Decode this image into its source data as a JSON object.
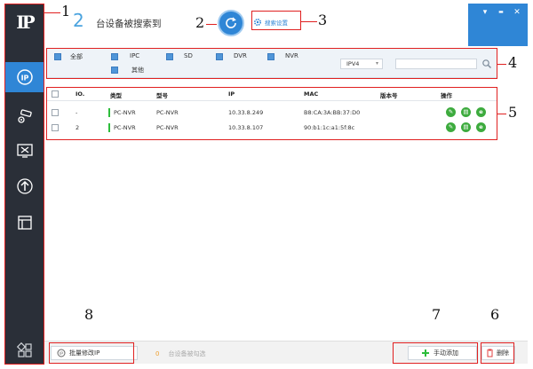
{
  "header": {
    "count": "2",
    "text": "台设备被搜索到",
    "settings_label": "搜索设置"
  },
  "window": {
    "menu_glyph": "▾",
    "minimize_glyph": "▬",
    "close_glyph": "✕"
  },
  "sidebar": {
    "logo": "IP",
    "items": [
      "ip-search-icon",
      "camera-settings-icon",
      "tools-icon",
      "upgrade-icon",
      "window-list-icon",
      "apps-icon"
    ]
  },
  "filter": {
    "types": [
      "全部",
      "IPC",
      "SD",
      "DVR",
      "NVR",
      "其他"
    ],
    "ip_version": "IPV4",
    "search_value": ""
  },
  "table": {
    "headers": [
      "IO.",
      "类型",
      "型号",
      "IP",
      "MAC",
      "版本号",
      "操作"
    ],
    "rows": [
      {
        "no": "-",
        "type": "PC-NVR",
        "model": "PC-NVR",
        "ip": "10.33.8.249",
        "mac": "B8:CA:3A:BB:37:D0",
        "version": ""
      },
      {
        "no": "2",
        "type": "PC-NVR",
        "model": "PC-NVR",
        "ip": "10.33.8.107",
        "mac": "90:b1:1c:a1:5f:8c",
        "version": ""
      }
    ],
    "op_glyph": "e"
  },
  "bottom": {
    "batch_label": "批量修改IP",
    "selected_count": "0",
    "selected_text": "台设备被勾选",
    "add_label": "手动添加",
    "delete_label": "删除"
  },
  "annotations": [
    "1",
    "2",
    "3",
    "4",
    "5",
    "6",
    "7",
    "8"
  ],
  "colors": {
    "accent": "#2f86d6",
    "sidebar": "#2a2f38",
    "green": "#3dab3e",
    "annotation": "#e02020"
  }
}
